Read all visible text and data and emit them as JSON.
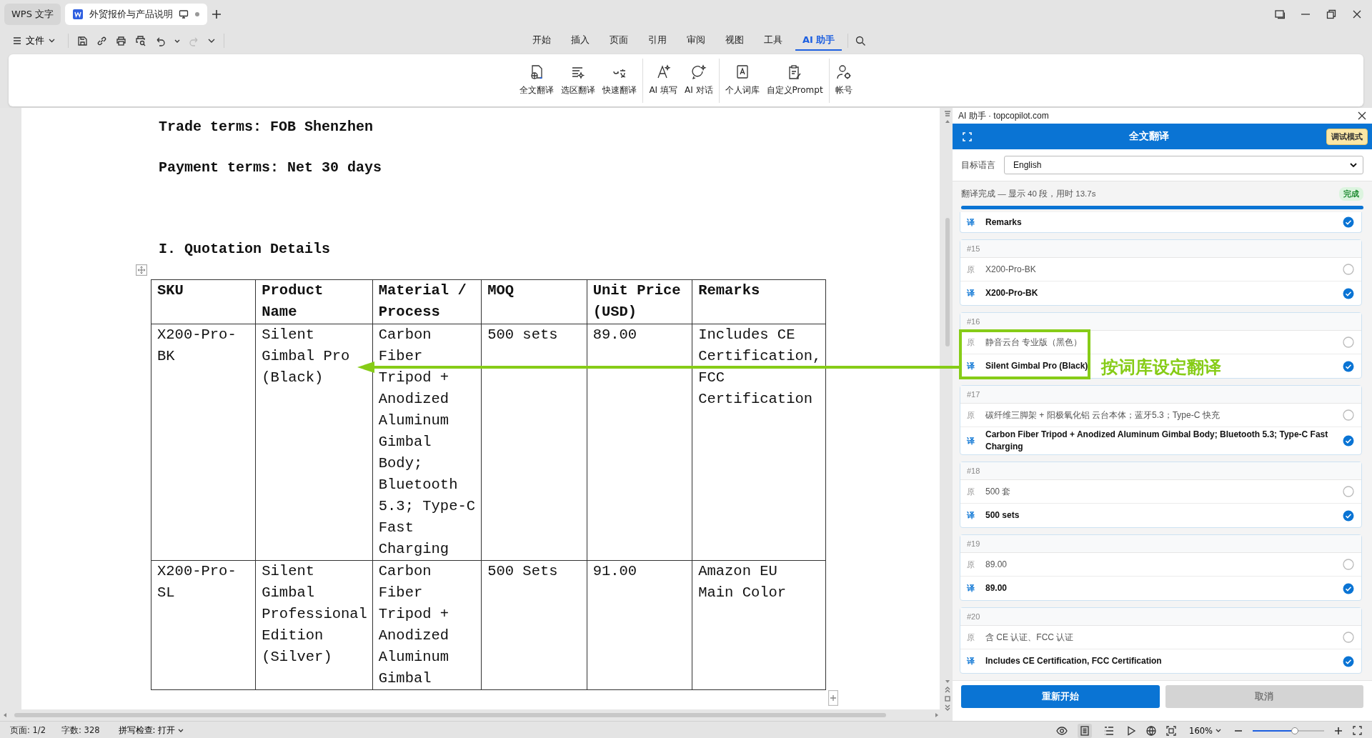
{
  "title_bar": {
    "tabs": [
      {
        "label": "WPS 文字",
        "kind": "app",
        "selected": false
      },
      {
        "label": "外贸报价与产品说明",
        "kind": "document",
        "selected": true
      }
    ]
  },
  "menu": {
    "file": "文件"
  },
  "ribbon_tabs": [
    {
      "label": "开始",
      "selected": false
    },
    {
      "label": "插入",
      "selected": false
    },
    {
      "label": "页面",
      "selected": false
    },
    {
      "label": "引用",
      "selected": false
    },
    {
      "label": "审阅",
      "selected": false
    },
    {
      "label": "视图",
      "selected": false
    },
    {
      "label": "工具",
      "selected": false
    },
    {
      "label": "AI 助手",
      "selected": true
    }
  ],
  "ribbon_groups": [
    {
      "buttons": [
        "全文翻译",
        "选区翻译",
        "快速翻译"
      ]
    },
    {
      "buttons": [
        "AI 填写",
        "AI 对话"
      ]
    },
    {
      "buttons": [
        "个人词库",
        "自定义Prompt"
      ]
    },
    {
      "buttons": [
        "帐号"
      ]
    }
  ],
  "document": {
    "paragraphs": [
      {
        "kind": "text",
        "text": "Trade terms: FOB Shenzhen"
      },
      {
        "kind": "text",
        "text": "Payment terms: Net 30 days"
      },
      {
        "kind": "heading",
        "text": "I.  Quotation Details"
      }
    ],
    "table": {
      "columns": [
        "SKU",
        "Product Name",
        "Material / Process",
        "MOQ",
        "Unit Price (USD)",
        "Remarks"
      ],
      "rows": [
        [
          "X200-Pro-BK",
          "Silent Gimbal Pro (Black)",
          "Carbon Fiber Tripod + Anodized Aluminum Gimbal Body; Bluetooth 5.3; Type-C Fast Charging",
          "500 sets",
          "89.00",
          "Includes CE Certification, FCC Certification"
        ],
        [
          "X200-Pro-SL",
          "Silent Gimbal Professional Edition (Silver)",
          "Carbon Fiber Tripod + Anodized Aluminum Gimbal",
          "500 Sets",
          "91.00",
          "Amazon EU Main Color"
        ]
      ]
    }
  },
  "assistant_panel": {
    "title": "AI 助手 · topcopilot.com",
    "header": "全文翻译",
    "mode_badge": "调试模式",
    "language_label": "目标语言",
    "language": "English",
    "status": "翻译完成 — 显示 40 段，用时 13.7s",
    "status_badge": "完成",
    "level": 1,
    "segments": [
      {
        "highlighted": false,
        "rows": [
          {
            "kind": "target",
            "tag": "译",
            "text": "Remarks",
            "checked": true
          }
        ]
      },
      {
        "number": "#15",
        "highlighted": false,
        "rows": [
          {
            "kind": "source",
            "tag": "原",
            "text": "X200-Pro-BK",
            "checked": false
          },
          {
            "kind": "target",
            "tag": "译",
            "text": "X200-Pro-BK",
            "checked": true
          }
        ]
      },
      {
        "number": "#16",
        "highlighted": true,
        "rows": [
          {
            "kind": "source",
            "tag": "原",
            "text": "静音云台 专业版（黑色）",
            "checked": false
          },
          {
            "kind": "target",
            "tag": "译",
            "text": "Silent Gimbal Pro (Black)",
            "checked": true
          }
        ]
      },
      {
        "number": "#17",
        "highlighted": false,
        "rows": [
          {
            "kind": "source",
            "tag": "原",
            "text": "碳纤维三脚架 + 阳极氧化铝 云台本体；蓝牙5.3；Type-C 快充",
            "checked": false
          },
          {
            "kind": "target",
            "tag": "译",
            "text": "Carbon Fiber Tripod + Anodized Aluminum Gimbal Body; Bluetooth 5.3; Type-C Fast Charging",
            "checked": true
          }
        ]
      },
      {
        "number": "#18",
        "highlighted": false,
        "rows": [
          {
            "kind": "source",
            "tag": "原",
            "text": "500 套",
            "checked": false
          },
          {
            "kind": "target",
            "tag": "译",
            "text": "500 sets",
            "checked": true
          }
        ]
      },
      {
        "number": "#19",
        "highlighted": false,
        "rows": [
          {
            "kind": "source",
            "tag": "原",
            "text": "89.00",
            "checked": false
          },
          {
            "kind": "target",
            "tag": "译",
            "text": "89.00",
            "checked": true
          }
        ]
      },
      {
        "number": "#20",
        "highlighted": false,
        "rows": [
          {
            "kind": "source",
            "tag": "原",
            "text": "含 CE 认证、FCC 认证",
            "checked": false
          },
          {
            "kind": "target",
            "tag": "译",
            "text": "Includes CE Certification, FCC Certification",
            "checked": true
          }
        ]
      }
    ],
    "buttons": [
      {
        "label": "重新开始",
        "disabled": false
      },
      {
        "label": "取消",
        "disabled": true
      }
    ]
  },
  "annotation": {
    "label": "按词库设定翻译"
  },
  "status_bar": {
    "page": "页面: 1/2",
    "words": "字数: 328",
    "spellcheck": "拼写检查: 打开",
    "views": [
      {
        "selected": true
      },
      {
        "selected": false
      }
    ],
    "zoom": "160%",
    "zoom_slider": {
      "level": 0.59
    }
  }
}
